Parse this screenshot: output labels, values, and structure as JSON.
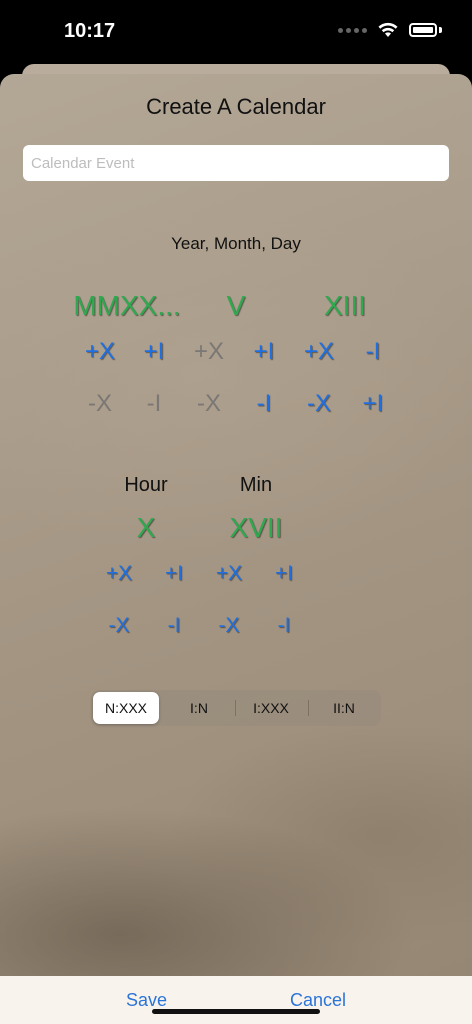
{
  "status_bar": {
    "time": "10:17"
  },
  "sheet": {
    "title": "Create A Calendar",
    "event_input": {
      "placeholder": "Calendar Event",
      "value": ""
    },
    "date": {
      "label": "Year, Month, Day",
      "year": {
        "value": "MMXX...",
        "plus_ten": "+X",
        "plus_one": "+I",
        "minus_ten": "-X",
        "minus_one": "-I"
      },
      "month": {
        "value": "V",
        "plus_ten": "+X",
        "plus_one": "+I",
        "minus_ten": "-X",
        "minus_one": "-I"
      },
      "day": {
        "value": "XIII",
        "plus_ten": "+X",
        "plus_one": "-I",
        "minus_ten": "-X",
        "minus_one": "+I"
      }
    },
    "time": {
      "hour": {
        "label": "Hour",
        "value": "X",
        "plus_ten": "+X",
        "plus_one": "+I",
        "minus_ten": "-X",
        "minus_one": "-I"
      },
      "min": {
        "label": "Min",
        "value": "XVII",
        "plus_ten": "+X",
        "plus_one": "+I",
        "minus_ten": "-X",
        "minus_one": "-I"
      }
    },
    "segments": {
      "options": [
        "N:XXX",
        "I:N",
        "I:XXX",
        "II:N"
      ],
      "selected": "N:XXX"
    }
  },
  "bottom_bar": {
    "save_label": "Save",
    "cancel_label": "Cancel"
  },
  "colors": {
    "roman_value": "#2fa84f",
    "button_blue": "#1f6fe0",
    "disabled_gray": "#7a7774"
  }
}
